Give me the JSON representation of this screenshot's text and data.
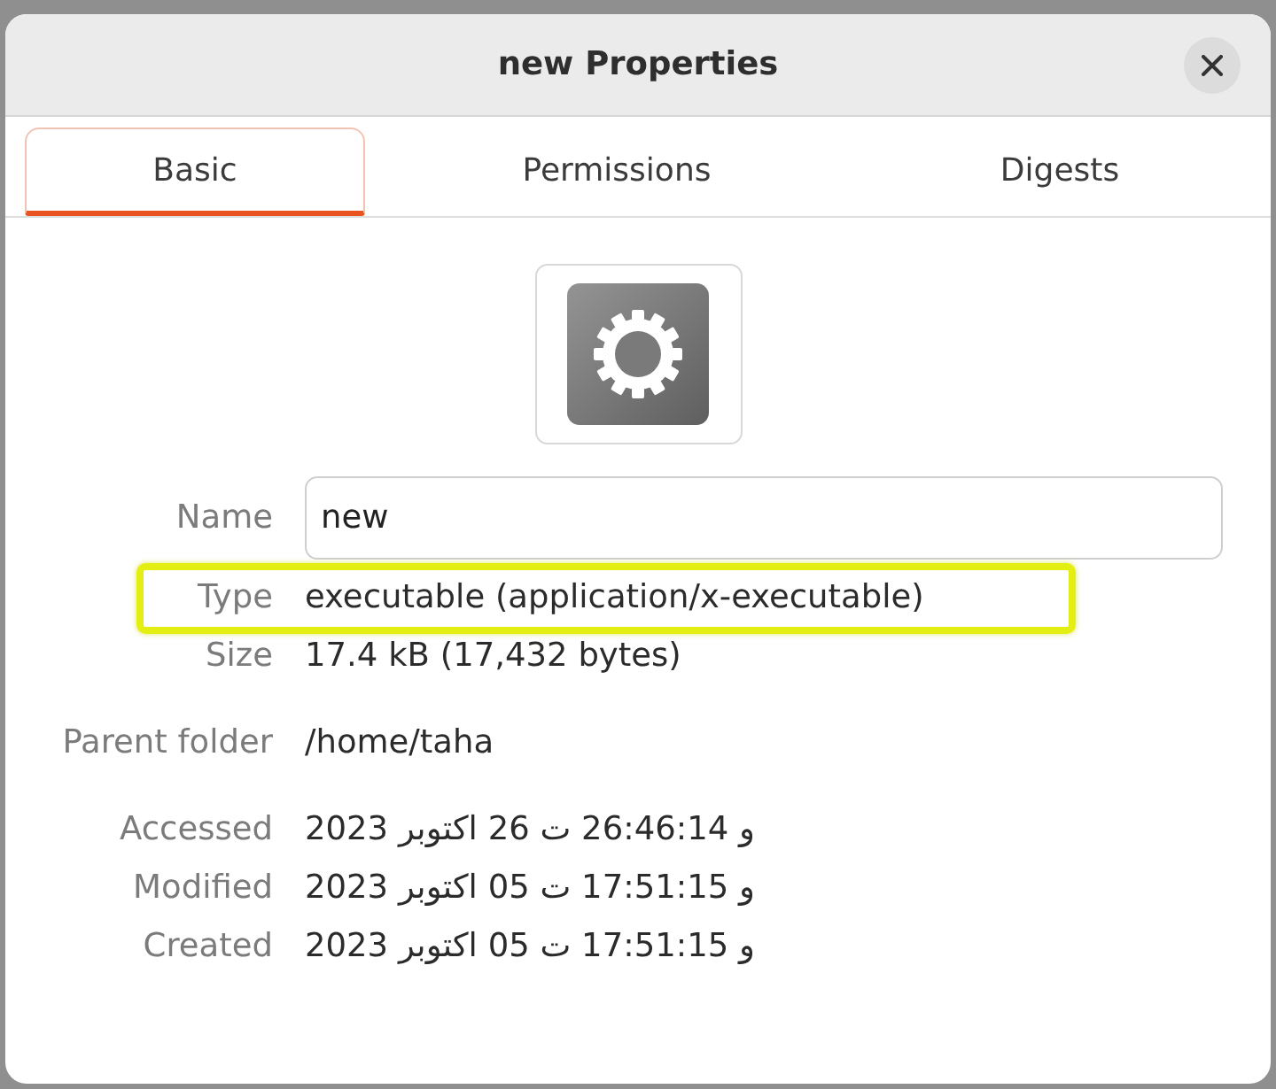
{
  "window": {
    "title": "new Properties"
  },
  "tabs": [
    {
      "label": "Basic",
      "selected": true
    },
    {
      "label": "Permissions",
      "selected": false
    },
    {
      "label": "Digests",
      "selected": false
    }
  ],
  "groups": [
    {
      "rows": [
        {
          "kind": "field",
          "label": "Name",
          "value": "new",
          "highlighted": false
        },
        {
          "kind": "text",
          "label": "Type",
          "value": "executable (application/x-executable)",
          "highlighted": true
        },
        {
          "kind": "text",
          "label": "Size",
          "value": "17.4 kB (17,432 bytes)",
          "highlighted": false
        }
      ]
    },
    {
      "rows": [
        {
          "kind": "text",
          "label": "Parent folder",
          "value": "/home/taha",
          "highlighted": false
        }
      ]
    },
    {
      "rows": [
        {
          "kind": "text",
          "label": "Accessed",
          "value": "و 26:46:14 ت 26 اكتوبر 2023",
          "highlighted": false
        },
        {
          "kind": "text",
          "label": "Modified",
          "value": "و 17:51:15 ت 05 اكتوبر 2023",
          "highlighted": false
        },
        {
          "kind": "text",
          "label": "Created",
          "value": "و 17:51:15 ت 05 اكتوبر 2023",
          "highlighted": false
        }
      ]
    }
  ]
}
